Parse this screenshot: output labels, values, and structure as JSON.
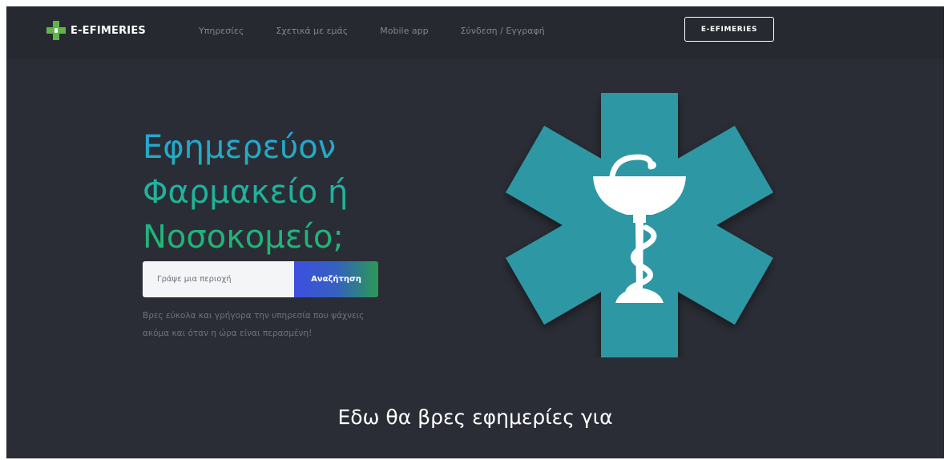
{
  "navbar": {
    "brand": "E-EFIMERIES",
    "links": [
      "Υπηρεσίες",
      "Σχετικά με εμάς",
      "Mobile app",
      "Σύνδεση / Εγγραφή"
    ],
    "cta_label": "E-EFIMERIES"
  },
  "hero": {
    "headline": [
      "Εφημερεύον",
      "Φαρμακείο ή",
      "Νοσοκομείο;"
    ],
    "search": {
      "placeholder": "Γράψε μια περιοχή",
      "button_label": "Αναζήτηση"
    },
    "subtext": "Βρες εύκολα και γρήγορα την υπηρεσία που ψάχνεις ακόμα και όταν η ώρα είναι περασμένη!"
  },
  "section": {
    "heading": "Εδω θα βρες εφημερίες για"
  },
  "icons": {
    "brand_logo": "pharmacy-cross-icon",
    "emblem": "star-of-life-bowl-of-hygieia-icon"
  },
  "colors": {
    "background": "#2b2d36",
    "navbar": "#272931",
    "emblem_teal": "#2f97a4",
    "brand_green": "#5fb54a",
    "headline_blue": "#27a4df",
    "headline_green": "#22b566",
    "button_blue": "#3d4fe0"
  }
}
